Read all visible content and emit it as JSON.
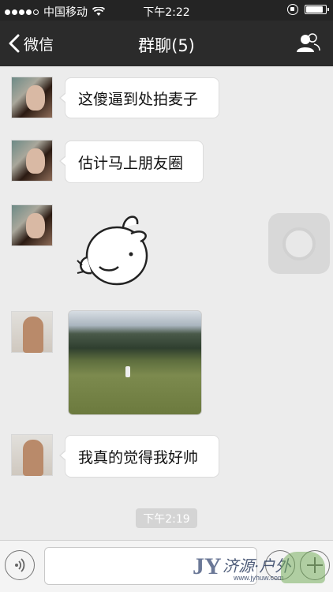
{
  "status_bar": {
    "carrier": "中国移动",
    "time": "下午2:22",
    "battery_level": 0.8
  },
  "nav": {
    "back_label": "微信",
    "title": "群聊(5)"
  },
  "messages": [
    {
      "sender": "girl",
      "text": "这傻逼到处拍麦子"
    },
    {
      "sender": "girl",
      "text": "估计马上朋友圈"
    },
    {
      "sender": "girl",
      "type": "sticker"
    },
    {
      "sender": "boy",
      "type": "photo"
    },
    {
      "sender": "boy",
      "text": "我真的觉得我好帅"
    }
  ],
  "timestamp": "下午2:19",
  "watermark": {
    "mark": "JY",
    "text": "济源·户外",
    "url": "www.jyhuw.com"
  },
  "colors": {
    "navbar": "#2b2b2b",
    "chat_background": "#ececec",
    "bubble": "#ffffff"
  }
}
